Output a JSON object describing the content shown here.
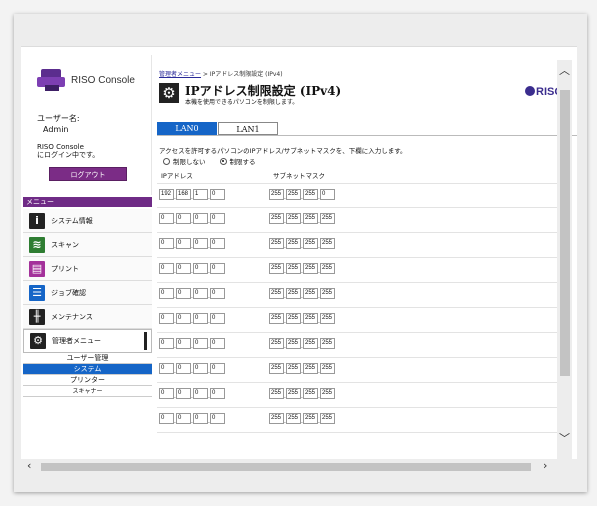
{
  "sidebar": {
    "logo_text": "RISO Console",
    "user_label": "ユーザー名:",
    "user_name": "Admin",
    "login_msg_1": "RISO Console",
    "login_msg_2": "にログイン中です。",
    "logout_label": "ログアウト",
    "menu_header": "メニュー",
    "menu_items": [
      {
        "label": "システム情報",
        "icon": "info-icon"
      },
      {
        "label": "スキャン",
        "icon": "scan-icon"
      },
      {
        "label": "プリント",
        "icon": "print-icon"
      },
      {
        "label": "ジョブ確認",
        "icon": "job-list-icon"
      },
      {
        "label": "メンテナンス",
        "icon": "maintenance-icon"
      },
      {
        "label": "管理者メニュー",
        "icon": "gear-icon"
      }
    ],
    "submenu": [
      {
        "label": "ユーザー管理"
      },
      {
        "label": "システム"
      },
      {
        "label": "プリンター"
      },
      {
        "label": "スキャナー"
      }
    ]
  },
  "main": {
    "breadcrumb_link": "管理者メニュー",
    "breadcrumb_rest": " > IPアドレス制限設定 (IPv4)",
    "title": "IPアドレス制限設定 (IPv4)",
    "subtitle": "本機を使用できるパソコンを制限します。",
    "brand": "RISO",
    "tabs": [
      "LAN0",
      "LAN1"
    ],
    "instruction": "アクセスを許可するパソコンのIPアドレス/サブネットマスクを、下欄に入力します。",
    "radio_no": "制限しない",
    "radio_yes": "制限する",
    "col_ip": "IPアドレス",
    "col_mask": "サブネットマスク",
    "rows": [
      {
        "ip": [
          "192",
          "168",
          "1",
          "0"
        ],
        "mask": [
          "255",
          "255",
          "255",
          "0"
        ]
      },
      {
        "ip": [
          "0",
          "0",
          "0",
          "0"
        ],
        "mask": [
          "255",
          "255",
          "255",
          "255"
        ]
      },
      {
        "ip": [
          "0",
          "0",
          "0",
          "0"
        ],
        "mask": [
          "255",
          "255",
          "255",
          "255"
        ]
      },
      {
        "ip": [
          "0",
          "0",
          "0",
          "0"
        ],
        "mask": [
          "255",
          "255",
          "255",
          "255"
        ]
      },
      {
        "ip": [
          "0",
          "0",
          "0",
          "0"
        ],
        "mask": [
          "255",
          "255",
          "255",
          "255"
        ]
      },
      {
        "ip": [
          "0",
          "0",
          "0",
          "0"
        ],
        "mask": [
          "255",
          "255",
          "255",
          "255"
        ]
      },
      {
        "ip": [
          "0",
          "0",
          "0",
          "0"
        ],
        "mask": [
          "255",
          "255",
          "255",
          "255"
        ]
      },
      {
        "ip": [
          "0",
          "0",
          "0",
          "0"
        ],
        "mask": [
          "255",
          "255",
          "255",
          "255"
        ]
      },
      {
        "ip": [
          "0",
          "0",
          "0",
          "0"
        ],
        "mask": [
          "255",
          "255",
          "255",
          "255"
        ]
      },
      {
        "ip": [
          "0",
          "0",
          "0",
          "0"
        ],
        "mask": [
          "255",
          "255",
          "255",
          "255"
        ]
      }
    ]
  },
  "colors": {
    "accent_blue": "#1565c7",
    "brand_purple": "#6f2b86"
  }
}
